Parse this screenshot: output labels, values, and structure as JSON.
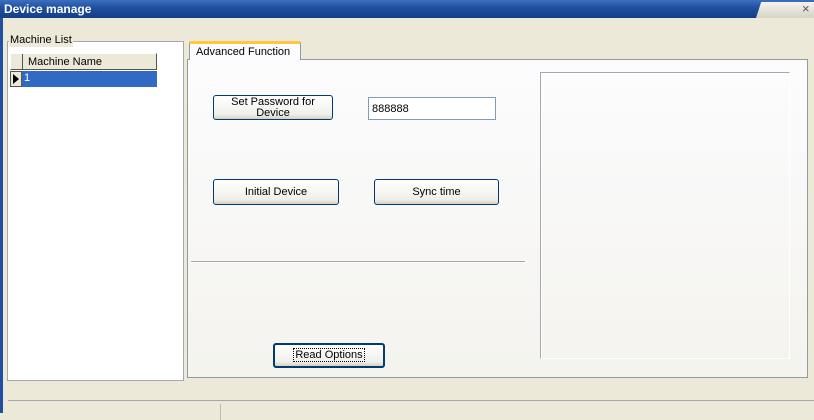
{
  "window": {
    "title": "Device manage",
    "close_glyph": "×"
  },
  "machine_list": {
    "legend": "Machine List",
    "column_header": "Machine Name",
    "rows": [
      {
        "name": "1",
        "selected": true
      }
    ]
  },
  "tabs": [
    {
      "label": "Advanced Function",
      "active": true
    }
  ],
  "advanced": {
    "set_password_line1": "Set Password for",
    "set_password_line2": "Device",
    "password_value": "888888",
    "initial_device_label": "Initial Device",
    "sync_time_label": "Sync time",
    "read_options_label": "Read Options"
  },
  "colors": {
    "titlebar": "#1f4f9e",
    "selection": "#316ac5",
    "tab_accent": "#ffc83c",
    "button_border": "#003c74"
  },
  "icons": {
    "row_indicator": "triangle-right"
  }
}
